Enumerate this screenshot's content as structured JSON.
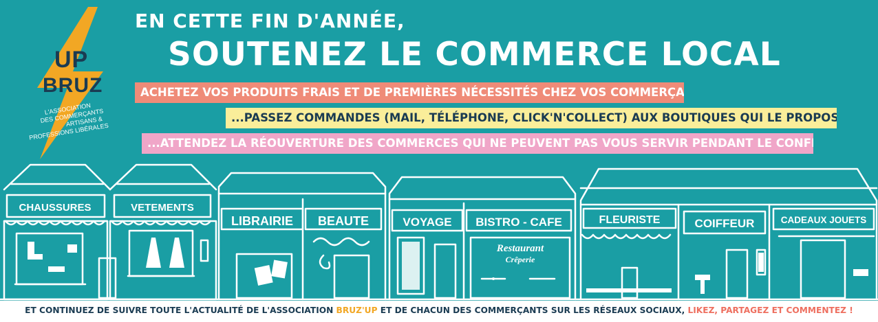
{
  "logo": {
    "line1": "UP",
    "line2": "BRUZ",
    "caption": [
      "L'ASSOCIATION",
      "DES COMMERÇANTS",
      "ARTISANS &",
      "PROFESSIONS LIBÉRALES"
    ]
  },
  "headline": {
    "line1": "EN CETTE FIN D'ANNÉE,",
    "line2": "SOUTENEZ LE COMMERCE LOCAL"
  },
  "strips": [
    "ACHETEZ VOS PRODUITS FRAIS ET DE PREMIÈRES NÉCESSITÉS CHEZ VOS COMMERÇANTS...",
    "...PASSEZ COMMANDES (MAIL, TÉLÉPHONE, CLICK'N'COLLECT) AUX BOUTIQUES QUI LE PROPOSENT...",
    "...ATTENDEZ LA RÉOUVERTURE DES COMMERCES QUI NE PEUVENT PAS VOUS SERVIR PENDANT LE CONFINEMENT"
  ],
  "shops": [
    "CHAUSSURES",
    "VETEMENTS",
    "LIBRAIRIE",
    "BEAUTE",
    "VOYAGE",
    "BISTRO - CAFE",
    "FLEURISTE",
    "COIFFEUR",
    "CADEAUX JOUETS"
  ],
  "restaurant_sign": {
    "line1": "Restaurant",
    "line2": "Crêperie"
  },
  "footer": {
    "part1": "ET CONTINUEZ DE SUIVRE TOUTE L'ACTUALITÉ DE L'ASSOCIATION ",
    "highlight1": "BRUZ'UP",
    "part2": " ET DE CHACUN DES COMMERÇANTS SUR LES RÉSEAUX SOCIAUX, ",
    "highlight2": "LIKEZ, PARTAGEZ ET COMMENTEZ !"
  },
  "colors": {
    "background": "#1a9ea4",
    "strip1": "#ef8b78",
    "strip2": "#faee9a",
    "strip3": "#f0a6c8",
    "bolt": "#f2a724",
    "text_dark": "#1a3b52"
  }
}
